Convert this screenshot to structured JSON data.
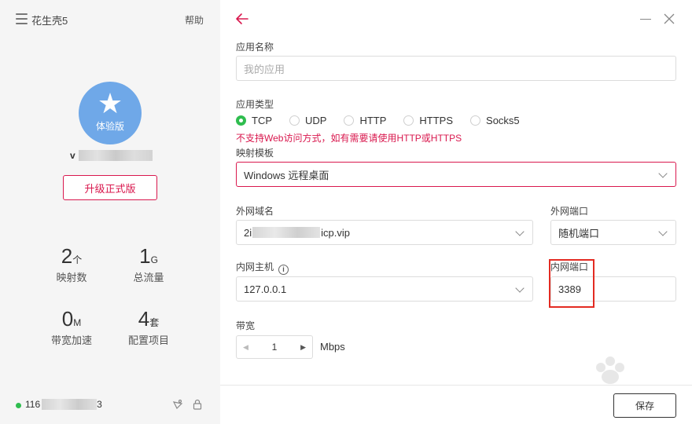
{
  "sidebar": {
    "app_title": "花生壳5",
    "help_label": "帮助",
    "avatar_badge": "体验版",
    "username_prefix": "v",
    "upgrade_label": "升级正式版",
    "stats": [
      {
        "value": "2",
        "unit": "个",
        "label": "映射数"
      },
      {
        "value": "1",
        "unit": "G",
        "label": "总流量"
      },
      {
        "value": "0",
        "unit": "M",
        "label": "带宽加速"
      },
      {
        "value": "4",
        "unit": "套",
        "label": "配置项目"
      }
    ],
    "status": {
      "ip_prefix": "116",
      "ip_suffix": "3",
      "online_color": "#2fbd4f"
    }
  },
  "form": {
    "app_name": {
      "label": "应用名称",
      "placeholder": "我的应用"
    },
    "app_type": {
      "label": "应用类型",
      "options": [
        "TCP",
        "UDP",
        "HTTP",
        "HTTPS",
        "Socks5"
      ],
      "selected": "TCP",
      "warning": "不支持Web访问方式，如有需要请使用HTTP或HTTPS"
    },
    "template": {
      "label": "映射模板",
      "value": "Windows 远程桌面"
    },
    "domain": {
      "label": "外网域名",
      "prefix": "2i",
      "suffix": "icp.vip"
    },
    "external_port": {
      "label": "外网端口",
      "value": "随机端口"
    },
    "internal_host": {
      "label": "内网主机",
      "value": "127.0.0.1"
    },
    "internal_port": {
      "label": "内网端口",
      "value": "3389"
    },
    "bandwidth": {
      "label": "带宽",
      "value": "1",
      "unit": "Mbps"
    },
    "save_label": "保存"
  },
  "colors": {
    "accent": "#d9184e",
    "success": "#2fbd4f",
    "avatar": "#6fa8e8"
  }
}
